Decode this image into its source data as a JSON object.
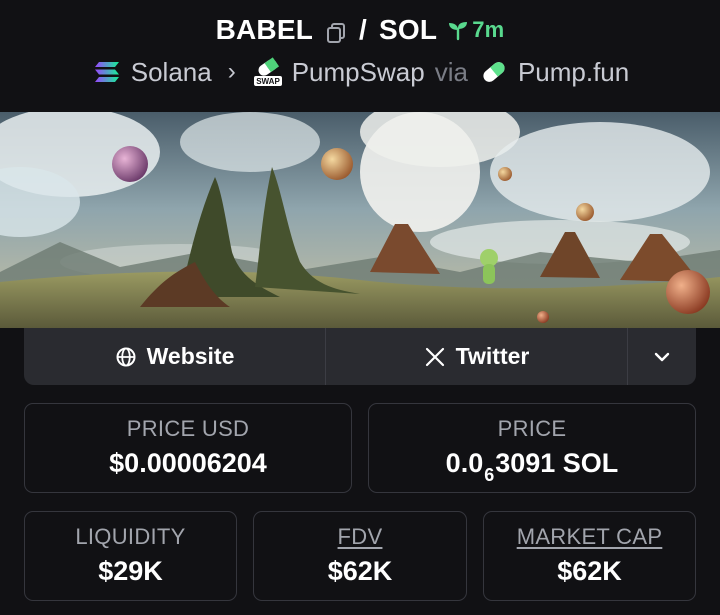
{
  "header": {
    "base_token": "BABEL",
    "separator": "/",
    "quote_token": "SOL",
    "age": "7m",
    "chain": "Solana",
    "dex": "PumpSwap",
    "via": "via",
    "launchpad": "Pump.fun",
    "dex_badge_text": "SWAP"
  },
  "links": {
    "website_label": "Website",
    "twitter_label": "Twitter"
  },
  "stats": {
    "price_usd": {
      "label": "PRICE USD",
      "value": "$0.00006204"
    },
    "price_native": {
      "label": "PRICE",
      "value_prefix": "0.0",
      "value_subscript": "6",
      "value_suffix": "3091 SOL"
    },
    "liquidity": {
      "label": "LIQUIDITY",
      "value": "$29K"
    },
    "fdv": {
      "label": "FDV",
      "value": "$62K"
    },
    "market_cap": {
      "label": "MARKET CAP",
      "value": "$62K"
    }
  },
  "colors": {
    "background": "#111114",
    "accent_green": "#59d98e",
    "card_border": "#35363d",
    "links_bar": "#2a2b30",
    "muted_text": "#a2a5ad"
  },
  "icons": {
    "copy": "copy-icon",
    "age": "seedling-icon",
    "chain": "solana-icon",
    "dex": "pumpswap-icon",
    "launchpad": "pill-icon",
    "website": "globe-icon",
    "twitter": "x-logo-icon",
    "more": "chevron-down-icon"
  }
}
